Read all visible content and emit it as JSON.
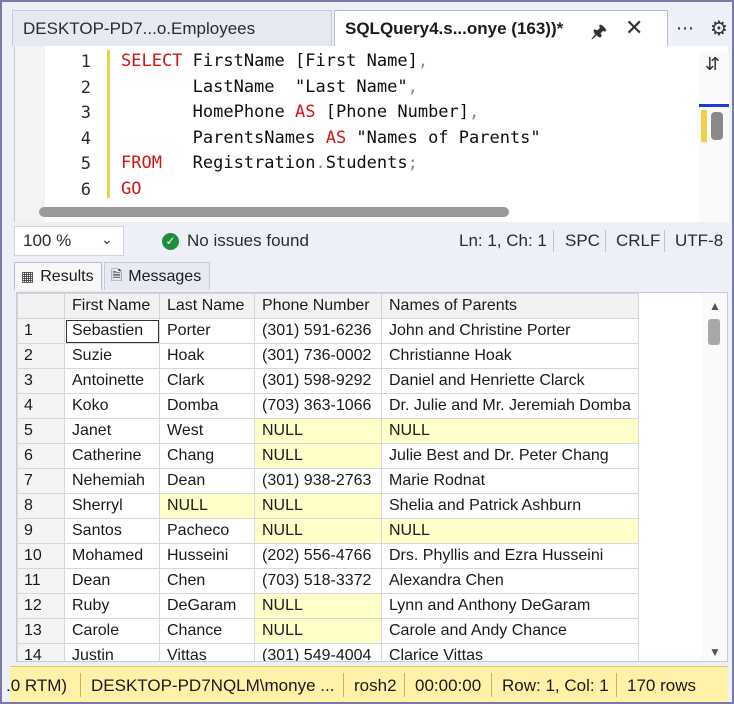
{
  "tabs": [
    {
      "label": "DESKTOP-PD7...o.Employees"
    },
    {
      "label": "SQLQuery4.s...onye (163))*"
    }
  ],
  "icons": {
    "pin": "pin-icon",
    "close": "close-icon",
    "more": "more-icon",
    "settings": "gear-icon"
  },
  "editor": {
    "line_numbers": [
      "1",
      "2",
      "3",
      "4",
      "5",
      "6"
    ],
    "lines": [
      [
        {
          "t": "SELECT ",
          "c": "kw"
        },
        {
          "t": "FirstName [First Name]",
          "c": "id"
        },
        {
          "t": ",",
          "c": "op"
        }
      ],
      [
        {
          "t": "       LastName  \"Last Name\"",
          "c": "id"
        },
        {
          "t": ",",
          "c": "op"
        }
      ],
      [
        {
          "t": "       HomePhone ",
          "c": "id"
        },
        {
          "t": "AS",
          "c": "kw"
        },
        {
          "t": " [Phone Number]",
          "c": "id"
        },
        {
          "t": ",",
          "c": "op"
        }
      ],
      [
        {
          "t": "       ParentsNames ",
          "c": "id"
        },
        {
          "t": "AS",
          "c": "kw"
        },
        {
          "t": " \"Names of Parents\"",
          "c": "id"
        }
      ],
      [
        {
          "t": "FROM   ",
          "c": "kw"
        },
        {
          "t": "Registration",
          "c": "id"
        },
        {
          "t": ".",
          "c": "op"
        },
        {
          "t": "Students",
          "c": "id"
        },
        {
          "t": ";",
          "c": "op"
        }
      ],
      [
        {
          "t": "GO",
          "c": "kw"
        }
      ]
    ]
  },
  "status": {
    "zoom": "100 %",
    "issues": "No issues found",
    "position": "Ln: 1, Ch: 1",
    "spacing": "SPC",
    "line_ending": "CRLF",
    "encoding": "UTF-8"
  },
  "results_tabs": {
    "results": "Results",
    "messages": "Messages"
  },
  "grid": {
    "columns": [
      "First Name",
      "Last Name",
      "Phone Number",
      "Names of Parents"
    ],
    "rows": [
      [
        "1",
        "Sebastien",
        "Porter",
        "(301) 591-6236",
        "John and Christine Porter"
      ],
      [
        "2",
        "Suzie",
        "Hoak",
        "(301) 736-0002",
        "Christianne Hoak"
      ],
      [
        "3",
        "Antoinette",
        "Clark",
        "(301) 598-9292",
        "Daniel and Henriette Clarck"
      ],
      [
        "4",
        "Koko",
        "Domba",
        "(703) 363-1066",
        "Dr. Julie and Mr. Jeremiah Domba"
      ],
      [
        "5",
        "Janet",
        "West",
        "NULL",
        "NULL"
      ],
      [
        "6",
        "Catherine",
        "Chang",
        "NULL",
        "Julie Best and Dr. Peter Chang"
      ],
      [
        "7",
        "Nehemiah",
        "Dean",
        "(301) 938-2763",
        "Marie Rodnat"
      ],
      [
        "8",
        "Sherryl",
        "NULL",
        "NULL",
        "Shelia and Patrick Ashburn"
      ],
      [
        "9",
        "Santos",
        "Pacheco",
        "NULL",
        "NULL"
      ],
      [
        "10",
        "Mohamed",
        "Husseini",
        "(202) 556-4766",
        "Drs. Phyllis and Ezra Husseini"
      ],
      [
        "11",
        "Dean",
        "Chen",
        "(703) 518-3372",
        "Alexandra Chen"
      ],
      [
        "12",
        "Ruby",
        "DeGaram",
        "NULL",
        "Lynn and Anthony DeGaram"
      ],
      [
        "13",
        "Carole",
        "Chance",
        "NULL",
        "Carole and Andy Chance"
      ],
      [
        "14",
        "Justin",
        "Vittas",
        "(301) 549-4004",
        "Clarice Vittas"
      ]
    ]
  },
  "bottom": {
    "version": ".0 RTM)",
    "server": "DESKTOP-PD7NQLM\\monye ...",
    "database": "rosh2",
    "elapsed": "00:00:00",
    "rowcol": "Row: 1, Col: 1",
    "rowcount": "170 rows"
  },
  "colors": {
    "keyword": "#d21414",
    "null_highlight": "#ffffc9",
    "status_bar": "#fff2a8",
    "ok": "#1e8e3e"
  }
}
